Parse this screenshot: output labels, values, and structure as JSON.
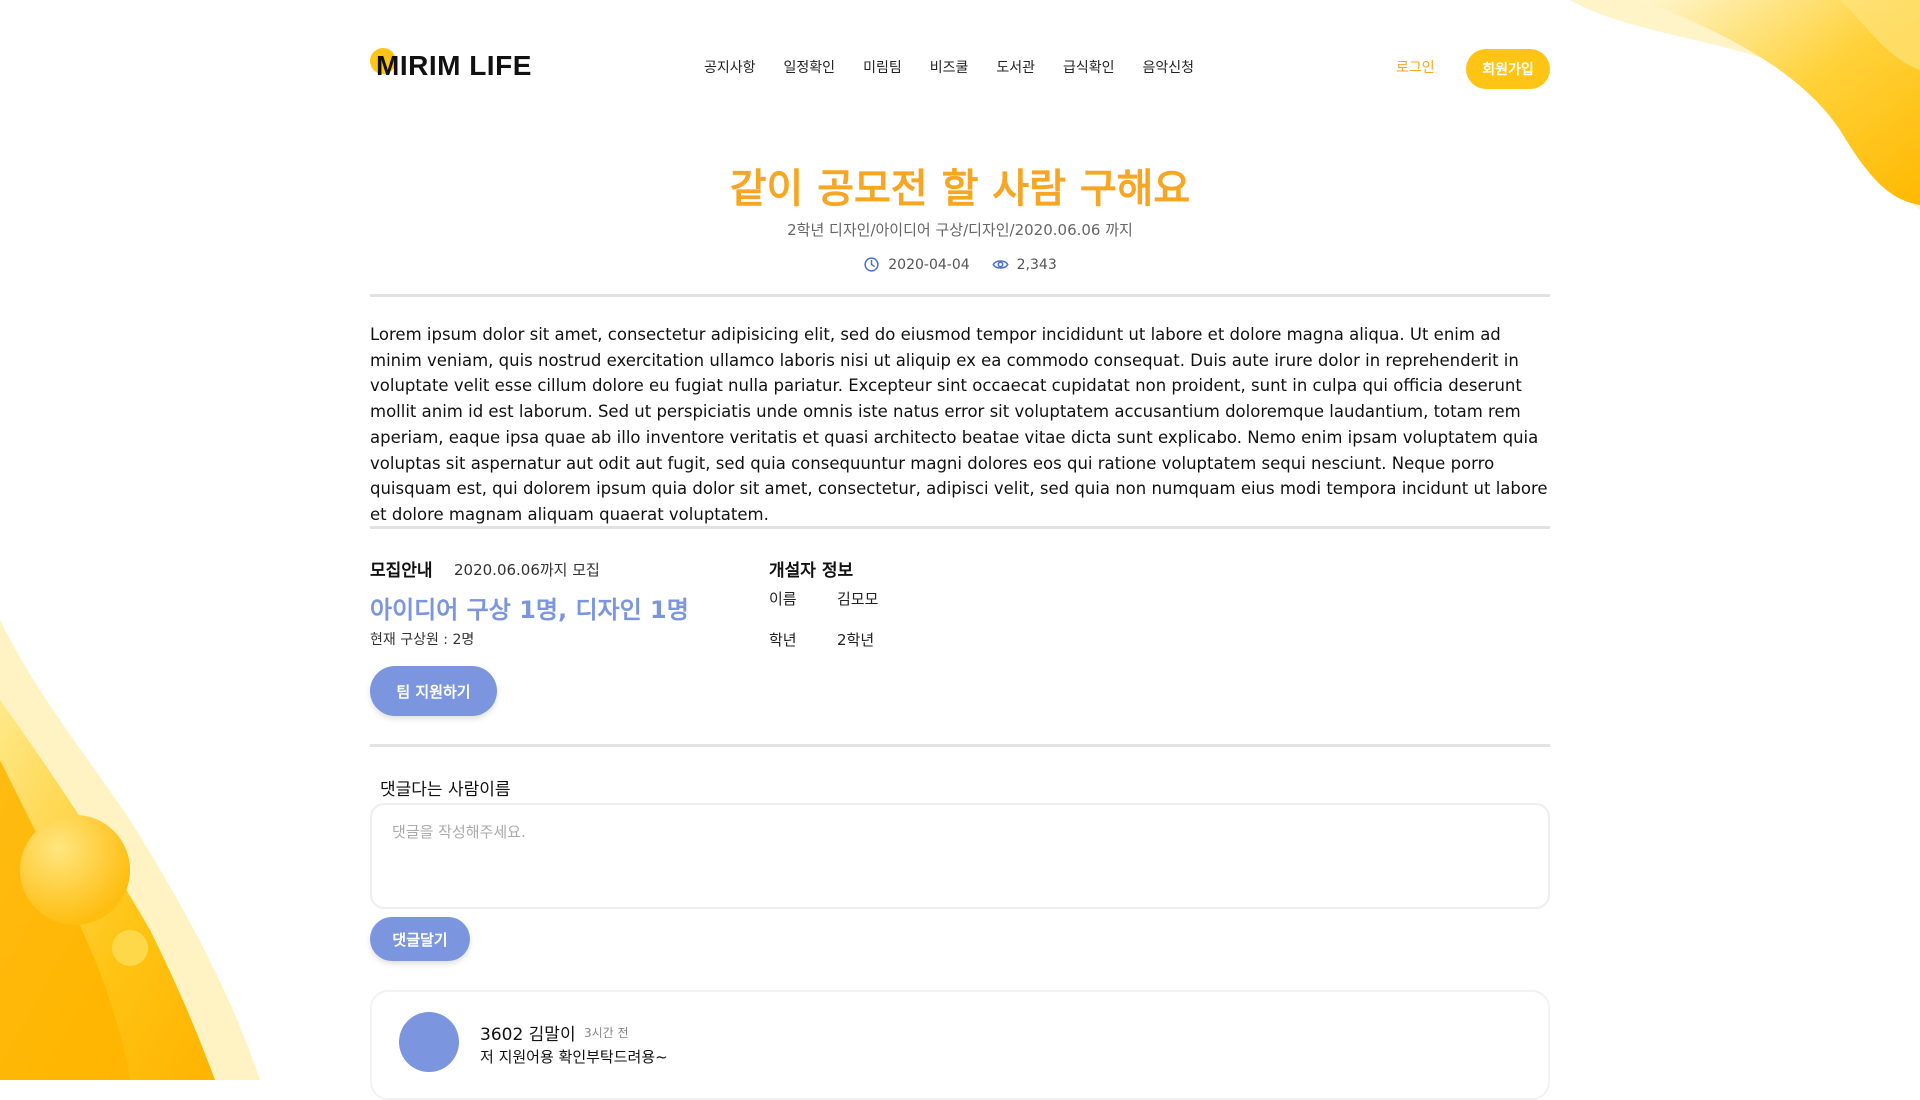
{
  "logo": {
    "text": "MIRIM LIFE"
  },
  "nav": {
    "items": [
      "공지사항",
      "일정확인",
      "미림팀",
      "비즈쿨",
      "도서관",
      "급식확인",
      "음악신청"
    ]
  },
  "auth": {
    "login": "로그인",
    "signup": "회원가입"
  },
  "post": {
    "title": "같이 공모전 할 사람 구해요",
    "subtitle": "2학년 디자인/아이디어 구상/디자인/2020.06.06 까지",
    "date": "2020-04-04",
    "views": "2,343",
    "body": "Lorem ipsum dolor sit amet, consectetur adipisicing elit, sed do eiusmod tempor incididunt ut labore et dolore magna aliqua. Ut enim ad minim veniam, quis nostrud exercitation ullamco laboris nisi ut aliquip ex ea commodo consequat. Duis aute irure dolor in reprehenderit in voluptate velit esse cillum dolore eu fugiat nulla pariatur. Excepteur sint occaecat cupidatat non proident, sunt in culpa qui officia deserunt mollit anim id est laborum. Sed ut perspiciatis unde omnis iste natus error sit voluptatem accusantium doloremque laudantium, totam rem aperiam, eaque ipsa quae ab illo inventore veritatis et quasi architecto beatae vitae dicta sunt explicabo. Nemo enim ipsam voluptatem quia voluptas sit aspernatur aut odit aut fugit, sed quia consequuntur magni dolores eos qui ratione voluptatem sequi nesciunt. Neque porro quisquam est, qui dolorem ipsum quia dolor sit amet, consectetur, adipisci velit, sed quia non numquam eius modi tempora incidunt ut labore et dolore magnam aliquam quaerat voluptatem."
  },
  "recruit": {
    "label": "모집안내",
    "deadline": "2020.06.06까지 모집",
    "roles": "아이디어 구상 1명, 디자인 1명",
    "current": "현재 구상원 : 2명",
    "apply_button": "팀 지원하기"
  },
  "developer": {
    "title": "개설자 정보",
    "name_label": "이름",
    "name_value": "김모모",
    "grade_label": "학년",
    "grade_value": "2학년"
  },
  "comment_form": {
    "commenter": "댓글다는 사람이름",
    "placeholder": "댓글을 작성해주세요.",
    "submit": "댓글달기"
  },
  "comments": [
    {
      "author": "3602 김말이",
      "time": "3시간 전",
      "text": "저 지원어용 확인부탁드려용~"
    }
  ],
  "colors": {
    "accent_yellow": "#ffc414",
    "title_orange": "#f6a623",
    "button_blue": "#7b96de"
  },
  "icons": {
    "date": "clock-icon",
    "views": "eye-icon"
  }
}
